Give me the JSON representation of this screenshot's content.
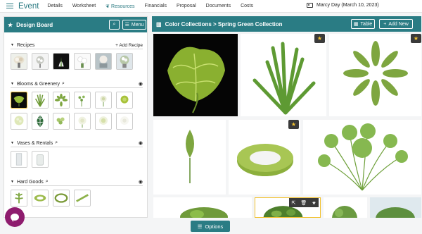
{
  "nav": {
    "brand": "Event",
    "links": [
      "Details",
      "Worksheet",
      "Resources",
      "Financials",
      "Proposal",
      "Documents",
      "Costs"
    ],
    "active": "Resources",
    "user": "Marcy Day (March 10, 2023)"
  },
  "board": {
    "title": "Design Board",
    "menu_label": "Menu",
    "sections": [
      {
        "title": "Recipes",
        "action": "Add Recipe"
      },
      {
        "title": "Blooms & Greenery"
      },
      {
        "title": "Vases & Rentals"
      },
      {
        "title": "Hard Goods"
      }
    ]
  },
  "gallery": {
    "breadcrumb": "Color Collections > Spring Green Collection",
    "table_label": "Table",
    "add_label": "Add New"
  },
  "footer": {
    "options_label": "Options"
  },
  "colors": {
    "teal": "#2a7c84",
    "star": "#f3c330",
    "chat": "#8e1c6e"
  },
  "icons": [
    "hamburger-icon",
    "star-icon",
    "search-icon",
    "menu-icon",
    "eye-icon",
    "plus-icon",
    "book-icon",
    "table-icon",
    "external-link-icon",
    "trash-icon",
    "chat-icon"
  ]
}
